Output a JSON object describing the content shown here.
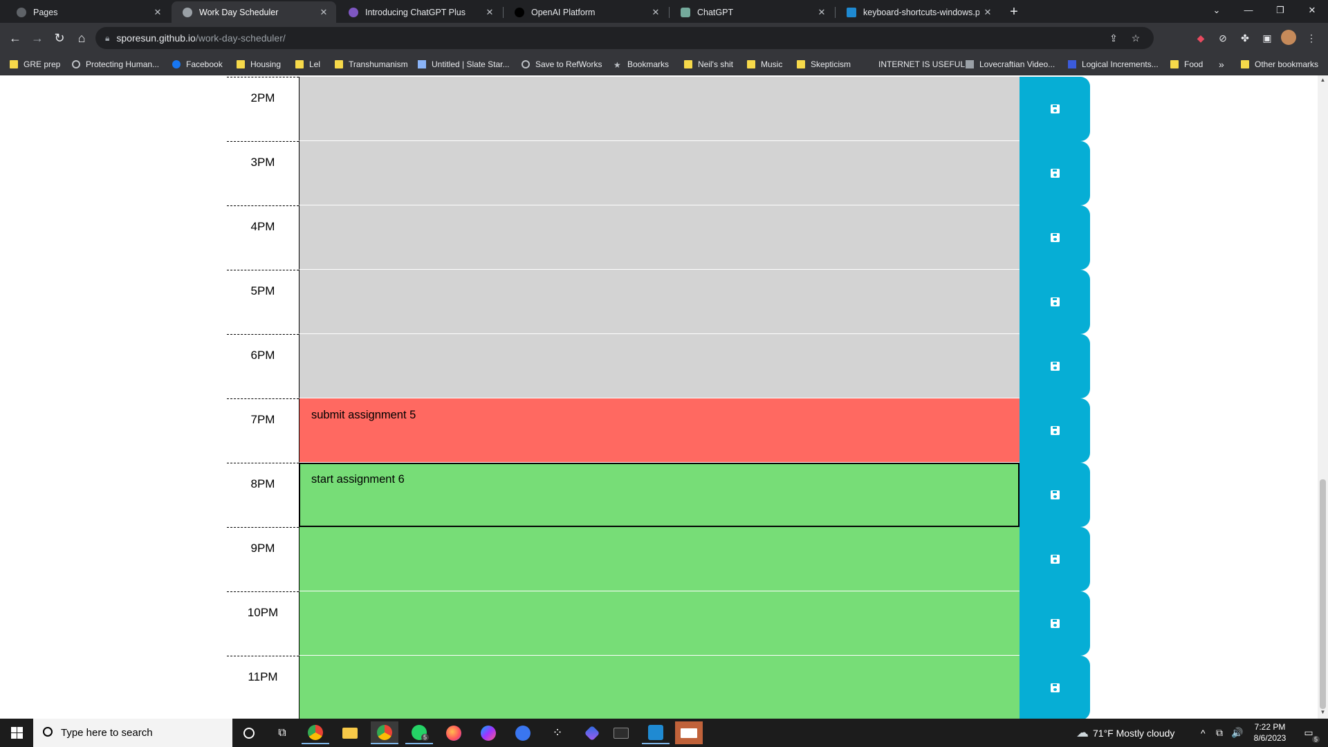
{
  "browser": {
    "tabs": [
      {
        "title": "Pages",
        "active": false
      },
      {
        "title": "Work Day Scheduler",
        "active": true
      },
      {
        "title": "Introducing ChatGPT Plus",
        "active": false
      },
      {
        "title": "OpenAI Platform",
        "active": false
      },
      {
        "title": "ChatGPT",
        "active": false
      },
      {
        "title": "keyboard-shortcuts-windows.pdf",
        "active": false
      }
    ],
    "tab_close": "✕",
    "new_tab": "+",
    "window_controls": {
      "tab_search": "⌄",
      "minimize": "—",
      "restore": "❐",
      "close": "✕"
    },
    "nav": {
      "back": "←",
      "forward": "→",
      "reload": "↻",
      "home": "⌂"
    },
    "url": {
      "host": "sporesun.github.io",
      "path": "/work-day-scheduler/"
    },
    "bookmarks": [
      {
        "label": "GRE prep",
        "icon": "folder-icon"
      },
      {
        "label": "Protecting Human...",
        "icon": "globe-icon"
      },
      {
        "label": "Facebook",
        "icon": "facebook-icon"
      },
      {
        "label": "Housing",
        "icon": "folder-icon"
      },
      {
        "label": "Lel",
        "icon": "folder-icon"
      },
      {
        "label": "Transhumanism",
        "icon": "folder-icon"
      },
      {
        "label": "Untitled | Slate Star...",
        "icon": "document-icon"
      },
      {
        "label": "Save to RefWorks",
        "icon": "globe-icon"
      },
      {
        "label": "Bookmarks",
        "icon": "star-icon"
      },
      {
        "label": "Neil's shit",
        "icon": "folder-icon"
      },
      {
        "label": "Music",
        "icon": "folder-icon"
      },
      {
        "label": "Skepticism",
        "icon": "folder-icon"
      },
      {
        "label": "INTERNET IS USEFUL",
        "icon": "none"
      },
      {
        "label": "Lovecraftian Video...",
        "icon": "document-icon"
      },
      {
        "label": "Logical Increments...",
        "icon": "document-icon"
      },
      {
        "label": "Food",
        "icon": "folder-icon"
      }
    ],
    "bookmarks_overflow": "»",
    "other_bookmarks": "Other bookmarks"
  },
  "scheduler": {
    "rows": [
      {
        "hour": "2PM",
        "text": "",
        "state": "past"
      },
      {
        "hour": "3PM",
        "text": "",
        "state": "past"
      },
      {
        "hour": "4PM",
        "text": "",
        "state": "past"
      },
      {
        "hour": "5PM",
        "text": "",
        "state": "past"
      },
      {
        "hour": "6PM",
        "text": "",
        "state": "past"
      },
      {
        "hour": "7PM",
        "text": "submit assignment 5",
        "state": "present"
      },
      {
        "hour": "8PM",
        "text": "start assignment 6",
        "state": "future"
      },
      {
        "hour": "9PM",
        "text": "",
        "state": "future"
      },
      {
        "hour": "10PM",
        "text": "",
        "state": "future"
      },
      {
        "hour": "11PM",
        "text": "",
        "state": "future"
      }
    ],
    "colors": {
      "past": "#d3d3d3",
      "present": "#ff6961",
      "future": "#77dd77",
      "save": "#06aed5"
    }
  },
  "taskbar": {
    "search_placeholder": "Type here to search",
    "weather": "71°F  Mostly cloudy",
    "time": "7:22 PM",
    "date": "8/6/2023",
    "whatsapp_badge": "5",
    "notification_badge": "5",
    "tray_icons": [
      "^",
      "⧉",
      "🔊"
    ]
  }
}
